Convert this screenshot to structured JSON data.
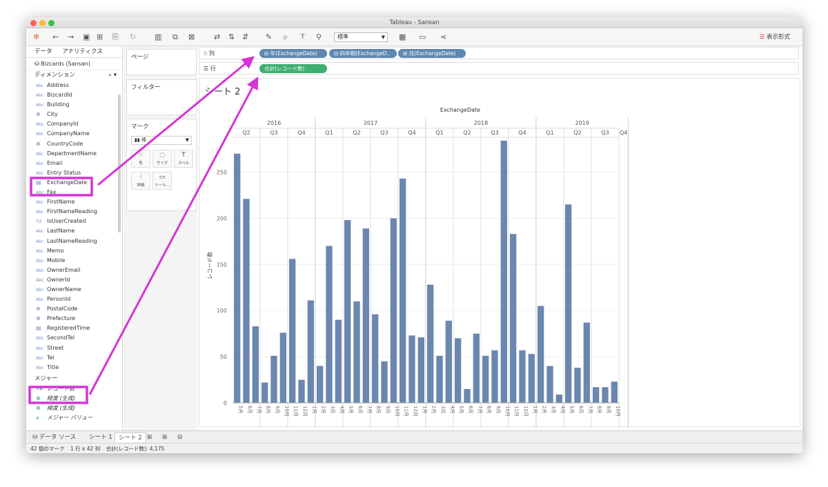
{
  "window": {
    "title": "Tableau - Sansan"
  },
  "toolbar": {
    "dropdown": "標準",
    "display_mode": "表示形式"
  },
  "left_panel": {
    "tab_data": "データ",
    "tab_analytics": "アナリティクス",
    "datasource": "Bizcards (Sansan)",
    "dimensions_header": "ディメンション",
    "dimensions": [
      {
        "icon": "Abc",
        "name": "Address"
      },
      {
        "icon": "Abc",
        "name": "BizcardId"
      },
      {
        "icon": "Abc",
        "name": "Building"
      },
      {
        "icon": "geo",
        "name": "City"
      },
      {
        "icon": "Abc",
        "name": "CompanyId"
      },
      {
        "icon": "Abc",
        "name": "CompanyName"
      },
      {
        "icon": "geo",
        "name": "CountryCode"
      },
      {
        "icon": "Abc",
        "name": "DepartmentName"
      },
      {
        "icon": "Abc",
        "name": "Email"
      },
      {
        "icon": "Abc",
        "name": "Entry Status"
      },
      {
        "icon": "date",
        "name": "ExchangeDate"
      },
      {
        "icon": "Abc",
        "name": "Fax"
      },
      {
        "icon": "Abc",
        "name": "FirstName"
      },
      {
        "icon": "Abc",
        "name": "FirstNameReading"
      },
      {
        "icon": "T|F",
        "name": "IsUserCreated"
      },
      {
        "icon": "Abc",
        "name": "LastName"
      },
      {
        "icon": "Abc",
        "name": "LastNameReading"
      },
      {
        "icon": "Abc",
        "name": "Memo"
      },
      {
        "icon": "Abc",
        "name": "Mobile"
      },
      {
        "icon": "Abc",
        "name": "OwnerEmail"
      },
      {
        "icon": "Abc",
        "name": "OwnerId"
      },
      {
        "icon": "Abc",
        "name": "OwnerName"
      },
      {
        "icon": "Abc",
        "name": "PersonId"
      },
      {
        "icon": "geo",
        "name": "PostalCode"
      },
      {
        "icon": "geo",
        "name": "Prefecture"
      },
      {
        "icon": "date",
        "name": "RegisteredTime"
      },
      {
        "icon": "Abc",
        "name": "SecondTel"
      },
      {
        "icon": "Abc",
        "name": "Street"
      },
      {
        "icon": "Abc",
        "name": "Tel"
      },
      {
        "icon": "Abc",
        "name": "Title"
      }
    ],
    "measures_header": "メジャー",
    "measures": [
      {
        "icon": "=#",
        "name": "レコード数"
      },
      {
        "icon": "geo",
        "name": "経度 (生成)"
      },
      {
        "icon": "geo",
        "name": "緯度 (生成)"
      },
      {
        "icon": "#",
        "name": "メジャー バリュー"
      }
    ]
  },
  "cards": {
    "pages": "ページ",
    "filters": "フィルター",
    "marks": "マーク",
    "mark_type": "棒",
    "mark_buttons": [
      "色",
      "サイズ",
      "ラベル",
      "詳細",
      "ツール..."
    ]
  },
  "shelves": {
    "columns_label": "列",
    "rows_label": "行",
    "column_pills": [
      "年(ExchangeDate)",
      "四半期(ExchangeD..",
      "月(ExchangeDate)"
    ],
    "row_pills": [
      "合計(レコード数)"
    ]
  },
  "sheet": {
    "title": "シート 2"
  },
  "chart_data": {
    "type": "bar",
    "title": "ExchangeDate",
    "ylabel": "レコード数",
    "ylim": [
      0,
      290
    ],
    "yticks": [
      0,
      50,
      100,
      150,
      200,
      250
    ],
    "years": [
      {
        "label": "2016",
        "quarters": [
          {
            "q": "Q2",
            "months": 3
          },
          {
            "q": "Q3",
            "months": 3
          },
          {
            "q": "Q4",
            "months": 3
          }
        ]
      },
      {
        "label": "2017",
        "quarters": [
          {
            "q": "Q1",
            "months": 3
          },
          {
            "q": "Q2",
            "months": 3
          },
          {
            "q": "Q3",
            "months": 3
          },
          {
            "q": "Q4",
            "months": 3
          }
        ]
      },
      {
        "label": "2018",
        "quarters": [
          {
            "q": "Q1",
            "months": 3
          },
          {
            "q": "Q2",
            "months": 3
          },
          {
            "q": "Q3",
            "months": 3
          },
          {
            "q": "Q4",
            "months": 3
          }
        ]
      },
      {
        "label": "2019",
        "quarters": [
          {
            "q": "Q1",
            "months": 3
          },
          {
            "q": "Q2",
            "months": 3
          },
          {
            "q": "Q3",
            "months": 3
          },
          {
            "q": "Q4",
            "months": 1
          }
        ]
      }
    ],
    "categories": [
      "4月",
      "5月",
      "6月",
      "7月",
      "8月",
      "9月",
      "10月",
      "11月",
      "12月",
      "1月",
      "2月",
      "3月",
      "4月",
      "5月",
      "6月",
      "7月",
      "8月",
      "9月",
      "10月",
      "11月",
      "12月",
      "1月",
      "2月",
      "3月",
      "4月",
      "5月",
      "6月",
      "7月",
      "8月",
      "9月",
      "10月",
      "11月",
      "12月",
      "1月",
      "2月",
      "3月",
      "4月",
      "5月",
      "6月",
      "7月",
      "8月",
      "9月",
      "10月"
    ],
    "values": [
      270,
      221,
      83,
      22,
      51,
      76,
      156,
      25,
      111,
      40,
      170,
      90,
      198,
      110,
      189,
      96,
      45,
      200,
      243,
      73,
      71,
      128,
      51,
      89,
      70,
      15,
      75,
      51,
      57,
      284,
      183,
      57,
      53,
      105,
      40,
      9,
      215,
      38,
      87,
      17,
      17,
      23
    ],
    "color": "#6b87b0"
  },
  "bottom_tabs": {
    "datasource": "データ ソース",
    "sheet1": "シート 1",
    "sheet2": "シート 2"
  },
  "status": {
    "marks": "42 個のマーク",
    "rows": "1 行 x 42 列",
    "sum": "合計(レコード数): 4,175"
  },
  "annotation_color": "#d633d6"
}
